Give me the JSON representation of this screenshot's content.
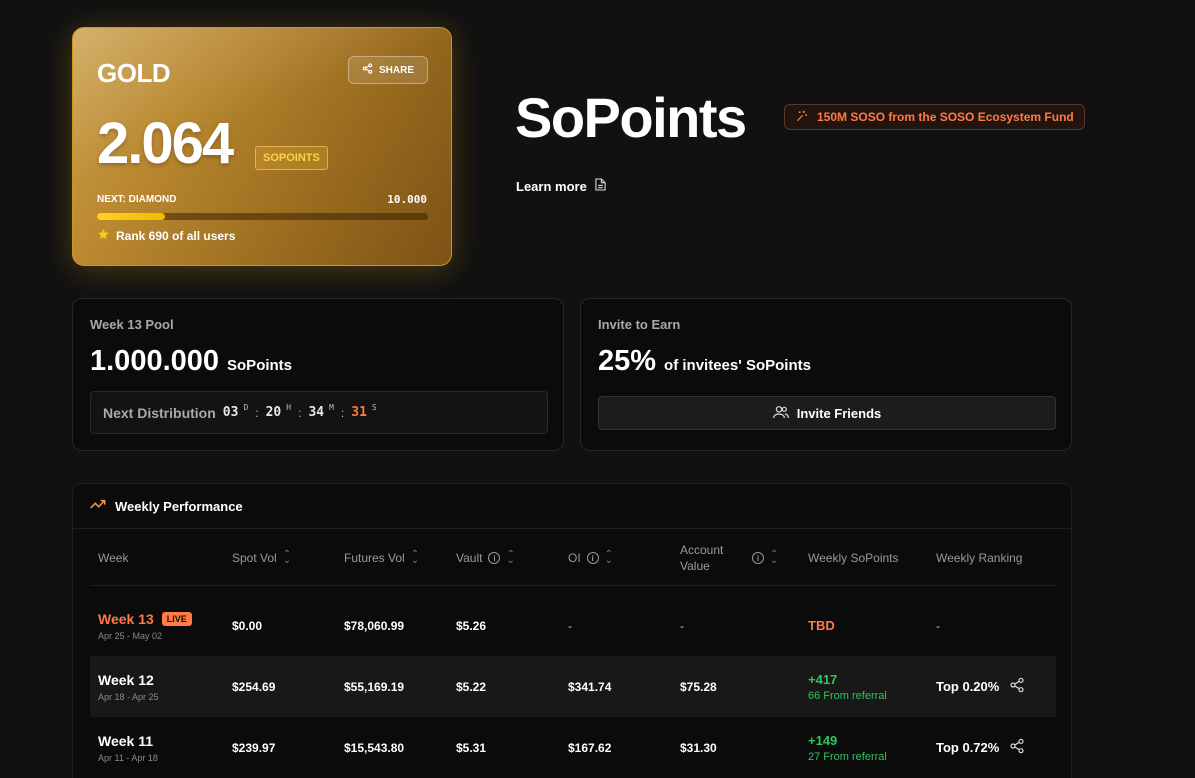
{
  "card": {
    "tier": "GOLD",
    "share_label": "SHARE",
    "points": "2.064",
    "points_unit": "SOPOINTS",
    "next_label": "NEXT: DIAMOND",
    "next_value": "10.000",
    "progress_fraction": 0.2064,
    "rank_text": "Rank 690 of all users"
  },
  "hero": {
    "title": "SoPoints",
    "fund_badge": "150M SOSO from the SOSO Ecosystem Fund",
    "learn_more": "Learn more"
  },
  "pool": {
    "title": "Week 13 Pool",
    "amount": "1.000.000",
    "unit": "SoPoints",
    "distribution_label": "Next Distribution",
    "days": "03",
    "days_unit": "D",
    "hours": "20",
    "hours_unit": "H",
    "minutes": "34",
    "minutes_unit": "M",
    "seconds": "31",
    "seconds_unit": "S"
  },
  "invite": {
    "title": "Invite to Earn",
    "percent": "25%",
    "text": "of invitees' SoPoints",
    "button_label": "Invite Friends"
  },
  "performance": {
    "title": "Weekly Performance",
    "columns": [
      "Week",
      "Spot Vol",
      "Futures Vol",
      "Vault",
      "OI",
      "Account Value",
      "Weekly SoPoints",
      "Weekly Ranking"
    ],
    "rows": [
      {
        "week": "Week 13",
        "live": "LIVE",
        "range": "Apr 25 - May 02",
        "spot": "$0.00",
        "futures": "$78,060.99",
        "vault": "$5.26",
        "oi": "-",
        "account": "-",
        "sopoints": "TBD",
        "referral": "",
        "ranking": "-"
      },
      {
        "week": "Week 12",
        "live": "",
        "range": "Apr 18 - Apr 25",
        "spot": "$254.69",
        "futures": "$55,169.19",
        "vault": "$5.22",
        "oi": "$341.74",
        "account": "$75.28",
        "sopoints": "+417",
        "referral": "66 From referral",
        "ranking": "Top 0.20%"
      },
      {
        "week": "Week 11",
        "live": "",
        "range": "Apr 11 - Apr 18",
        "spot": "$239.97",
        "futures": "$15,543.80",
        "vault": "$5.31",
        "oi": "$167.62",
        "account": "$31.30",
        "sopoints": "+149",
        "referral": "27 From referral",
        "ranking": "Top 0.72%"
      }
    ]
  }
}
